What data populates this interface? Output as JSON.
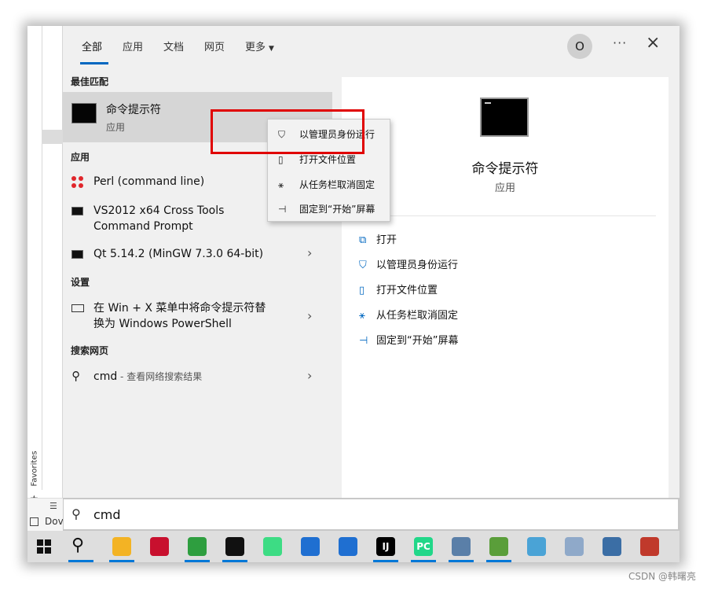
{
  "tabs": {
    "items": [
      {
        "label": "全部",
        "active": true
      },
      {
        "label": "应用"
      },
      {
        "label": "文档"
      },
      {
        "label": "网页"
      },
      {
        "label": "更多"
      }
    ],
    "avatar_letter": "O",
    "more_glyph": "···",
    "close_glyph": "×"
  },
  "behind_window": {
    "favorites_label": "Favorites",
    "bottom_text": "Dov"
  },
  "sections": {
    "best_match": "最佳匹配",
    "apps": "应用",
    "settings": "设置",
    "web": "搜索网页"
  },
  "best_match": {
    "title": "命令提示符",
    "subtitle": "应用"
  },
  "apps": [
    {
      "label": "Perl (command line)"
    },
    {
      "label_line1": "VS2012 x64 Cross Tools",
      "label_line2": "Command Prompt"
    },
    {
      "label": "Qt 5.14.2 (MinGW 7.3.0 64-bit)"
    }
  ],
  "settings": [
    {
      "label_line1": "在 Win + X 菜单中将命令提示符替",
      "label_line2": "换为 Windows PowerShell"
    }
  ],
  "web": {
    "query": "cmd",
    "suffix": " - 查看网络搜索结果"
  },
  "detail": {
    "name": "命令提示符",
    "kind": "应用",
    "actions": [
      {
        "label": "打开"
      },
      {
        "label": "以管理员身份运行"
      },
      {
        "label": "打开文件位置"
      },
      {
        "label": "从任务栏取消固定"
      },
      {
        "label": "固定到“开始”屏幕"
      }
    ]
  },
  "context_menu": [
    {
      "label": "以管理员身份运行"
    },
    {
      "label": "打开文件位置"
    },
    {
      "label": "从任务栏取消固定"
    },
    {
      "label": "固定到“开始”屏幕"
    }
  ],
  "search": {
    "value": "cmd"
  },
  "taskbar": {
    "apps": [
      {
        "name": "file-explorer",
        "color": "#f3b324"
      },
      {
        "name": "media-player",
        "color": "#c8102e"
      },
      {
        "name": "paint",
        "color": "#2e9e3f"
      },
      {
        "name": "command-prompt",
        "color": "#111111"
      },
      {
        "name": "android-studio",
        "color": "#3ddc84"
      },
      {
        "name": "app-blue-1",
        "color": "#1f6fd1"
      },
      {
        "name": "app-blue-2",
        "color": "#1f6fd1"
      },
      {
        "name": "intellij",
        "color": "#000000",
        "text": "IJ"
      },
      {
        "name": "pycharm",
        "color": "#21d789",
        "text": "PC"
      },
      {
        "name": "tool-gear",
        "color": "#5a7fa8"
      },
      {
        "name": "notepad-chart",
        "color": "#5a9e3a"
      },
      {
        "name": "pen-tool",
        "color": "#4aa3d6"
      },
      {
        "name": "image-viewer",
        "color": "#8fa9c9"
      },
      {
        "name": "calculator",
        "color": "#3b6ea5"
      },
      {
        "name": "wireless",
        "color": "#c0392b"
      }
    ]
  },
  "watermark": "CSDN @韩曙亮"
}
